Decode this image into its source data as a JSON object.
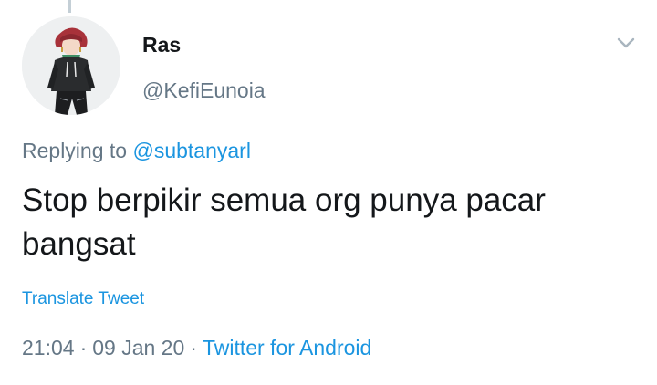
{
  "tweet": {
    "author": {
      "display_name": "Ras",
      "handle": "@KefiEunoia",
      "avatar_icon": "anime-character-avatar"
    },
    "more_icon": "chevron-down-icon",
    "replying_prefix": "Replying to",
    "replying_to": "@subtanyarl",
    "text": "Stop berpikir semua org punya pacar bangsat",
    "translate_label": "Translate Tweet",
    "time": "21:04",
    "separator": "·",
    "date": "09 Jan 20",
    "source": "Twitter for Android"
  },
  "colors": {
    "primary_text": "#14171a",
    "secondary_text": "#657786",
    "link": "#1b95e0",
    "thread_line": "#c4cfd6"
  }
}
